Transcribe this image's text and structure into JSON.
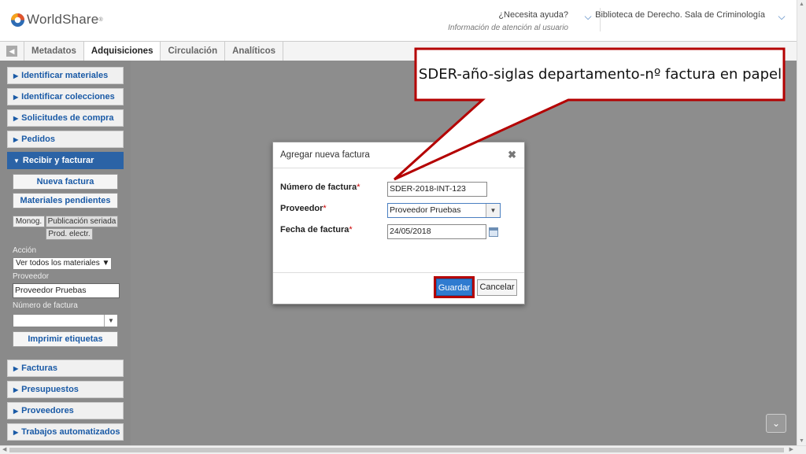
{
  "header": {
    "brand": "WorldShare",
    "help_title": "¿Necesita ayuda?",
    "help_subtitle": "Información de atención al usuario",
    "library": "Biblioteca de Derecho. Sala de Criminología",
    "accent_color": "#2d6cb5",
    "logo_colors": [
      "#e2542b",
      "#f7a41d",
      "#2d6cb5"
    ]
  },
  "nav": {
    "tabs": [
      {
        "label": "Metadatos",
        "active": false
      },
      {
        "label": "Adquisiciones",
        "active": true
      },
      {
        "label": "Circulación",
        "active": false
      },
      {
        "label": "Analíticos",
        "active": false
      }
    ]
  },
  "sidebar": {
    "items_top": [
      "Identificar materiales",
      "Identificar colecciones",
      "Solicitudes de compra",
      "Pedidos"
    ],
    "active_item": "Recibir y facturar",
    "buttons": [
      "Nueva factura",
      "Materiales pendientes"
    ],
    "subtabs": [
      "Monog.",
      "Publicación seriada",
      "Prod. electr."
    ],
    "action_label": "Acción",
    "action_value": "Ver todos los materiales",
    "vendor_label": "Proveedor",
    "vendor_value": "Proveedor Pruebas",
    "invoice_label": "Número de factura",
    "invoice_value": "",
    "print_button": "Imprimir etiquetas",
    "items_bottom": [
      "Facturas",
      "Presupuestos",
      "Proveedores",
      "Trabajos automatizados"
    ]
  },
  "dialog": {
    "title": "Agregar nueva factura",
    "fields": {
      "invoice_number_label": "Número de factura",
      "invoice_number_value": "SDER-2018-INT-123",
      "vendor_label": "Proveedor",
      "vendor_value": "Proveedor Pruebas",
      "date_label": "Fecha de factura",
      "date_value": "24/05/2018"
    },
    "required_mark": "*",
    "save_label": "Guardar",
    "cancel_label": "Cancelar"
  },
  "callout": {
    "text": "SDER-año-siglas departamento-nº factura en papel",
    "border_color": "#b40000"
  }
}
